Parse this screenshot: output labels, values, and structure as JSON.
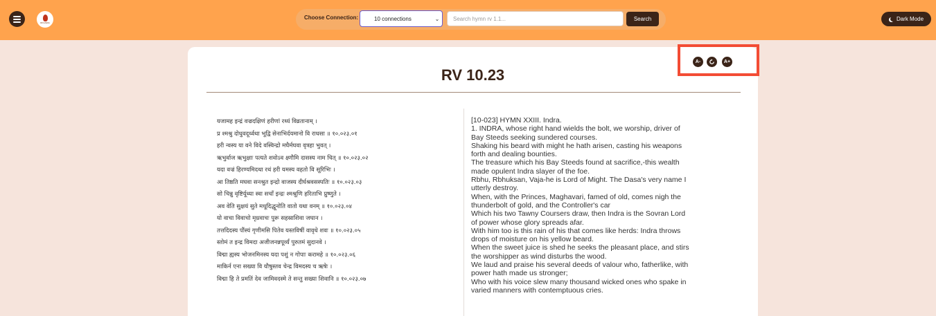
{
  "header": {
    "logo_text": "RIGVEDA",
    "connection_label": "Choose Connection:",
    "connection_value": "10 connections",
    "search_placeholder": "Search hymn rv 1.1...",
    "search_button": "Search",
    "dark_mode_label": "Dark Mode"
  },
  "font_controls": {
    "decrease": "A-",
    "reset": "reset-icon",
    "increase": "A+"
  },
  "hymn": {
    "title": "RV 10.23",
    "sanskrit_lines": [
      "यजामह इन्द्रं वज्रदक्षिणं हरीणां रथ्यं विव्रतानाम् ।",
      "प्र श्मश्रु दोधुवदूर्ध्वथा भूद्वि सेनाभिर्दयमानो वि राधसा ॥ १०.०२३.०१",
      "हरी न्वस्य या वने विदे वस्विन्द्रो मघैर्मघवा वृत्रहा भुवत् ।",
      "ऋभुर्वाज ऋभुक्षाः पत्यते शवोऽव क्ष्णौमि दासस्य नाम चित् ॥ १०.०२३.०२",
      "यदा वज्रं हिरण्यमिदथा रथं हरी यमस्य वहतो वि सूरिभिः ।",
      "आ तिष्ठति मघवा सनश्रुत इन्द्रो वाजस्य दीर्घश्रवसस्पतिः ॥ १०.०२३.०३",
      "सो चिन्नु वृष्टिर्यूथ्या स्वा सचाँ इन्द्रः श्मश्रूणि हरिताभि प्रुष्णुते ।",
      "अव वेति सुक्षयं सुते मधूदिद्धूनोति वातो यथा वनम् ॥ १०.०२३.०४",
      "यो वाचा विवाचो मृध्रवाचः पुरू सहस्राशिवा जघान ।",
      "तत्तदिदस्य पौंस्यं गृणीमसि पितेव यस्तविषीं वावृधे शवः ॥ १०.०२३.०५",
      "स्तोमं त इन्द्र विमदा अजीजनन्नपूर्व्यं पुरुतमं सुदानवे ।",
      "विद्मा ह्यस्य भोजनमिनस्य यदा पशुं न गोपाः करामहे ॥ १०.०२३.०६",
      "माकिर्न एना सख्या वि यौषुस्तव चेन्द्र विमदस्य च ऋषेः ।",
      "विद्मा हि ते प्रमतिं देव जामिवदस्मे ते सन्तु सख्या शिवानि ॥ १०.०२३.०७"
    ],
    "english_lines": [
      "[10-023] HYMN XXIII. Indra.",
      "1. INDRA, whose right hand wields the bolt, we worship, driver of",
      "Bay Steeds seeking sundered courses.",
      "Shaking his beard with might he hath arisen, casting his weapons",
      "forth and dealing bounties.",
      "The treasure which his Bay Steeds found at sacrifice,-this wealth",
      "made opulent Indra slayer of the foe.",
      "Rbhu, Rbhuksan, Vaja-he is Lord of Might. The Dasa's very name I",
      "utterly destroy.",
      "When, with the Princes, Maghavari, famed of old, comes nigh the",
      "thunderbolt of gold, and the Controller's car",
      "Which his two Tawny Coursers draw, then Indra is the Sovran Lord",
      "of power whose glory spreads afar.",
      "With him too is this rain of his that comes like herds: Indra throws",
      "drops of moisture on his yellow beard.",
      "When the sweet juice is shed he seeks the pleasant place, and stirs",
      "the worshipper as wind disturbs the wood.",
      "We laud and praise his several deeds of valour who, fatherlike, with",
      "power hath made us stronger;",
      "Who with his voice slew many thousand wicked ones who spake in",
      "varied manners with contemptuous cries."
    ]
  }
}
